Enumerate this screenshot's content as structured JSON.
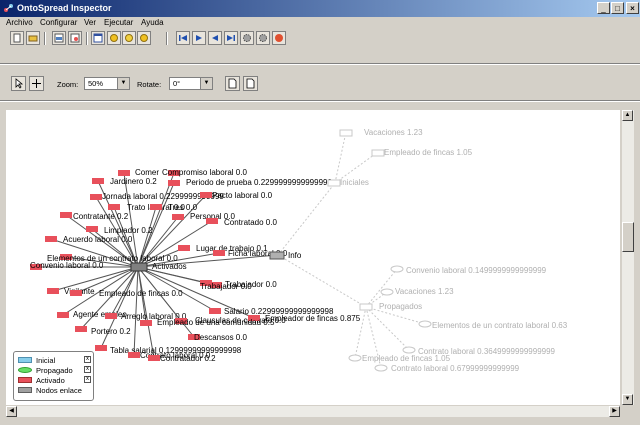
{
  "window": {
    "title": "OntoSpread Inspector"
  },
  "menu": [
    "Archivo",
    "Configurar",
    "Ver",
    "Ejecutar",
    "Ayuda"
  ],
  "options": {
    "zoom_label": "Zoom:",
    "zoom_value": "50%",
    "rotate_label": "Rotate:",
    "rotate_value": "0°"
  },
  "legend": {
    "items": [
      {
        "label": "Inicial",
        "color": "#87ceeb",
        "shape": "rect"
      },
      {
        "label": "Propagado",
        "color": "#66dd66",
        "shape": "ellipse"
      },
      {
        "label": "Activado",
        "color": "#e8505b",
        "shape": "rect"
      },
      {
        "label": "Nodos enlace",
        "color": "#a0a0a0",
        "shape": "rect"
      }
    ]
  },
  "colors": {
    "active": "#e8505b",
    "faded": "#c8c8c8",
    "hub": "#808080"
  },
  "graph": {
    "hub_label": "Activados",
    "info_label": "Info",
    "iniciales_label": "Iniciales",
    "propagados_label": "Propagados",
    "active_nodes": [
      "Comer",
      "Compromiso laboral 0.0",
      "Jardinero 0.2",
      "Periodo de prueba 0.2299999999999999",
      "Jornada laboral 0.2299999999999",
      "Pacto laboral 0.0",
      "Trato laboral 0.0",
      "Contratante 0.2",
      "Tres 0.0",
      "Personal 0.0",
      "Limpiador 0.2",
      "Contratado 0.0",
      "Acuerdo laboral 0.0",
      "Elementos de un contrato laboral 0.0",
      "Lugar de trabajo 0.1",
      "Ficha laboral 0.0",
      "Convenio laboral 0.0",
      "Trabajador 0.0",
      "Vigilante",
      "Empleado de fincas 0.0",
      "Trabajador 0.0",
      "Salario 0.22999999999999998",
      "Agente empleo",
      "Arreglo laboral 0.0",
      "Clausulas de contrato 0.0",
      "Empleador de fincas 0.875",
      "Empleado de una comunidad 0.5",
      "Portero 0.2",
      "Descansos 0.0",
      "Tabla salarial 0.12999999999999998",
      "Contrato laboral 0.0",
      "Contratador 0.2"
    ],
    "faded_nodes": [
      "Vacaciones 1.23",
      "Empleado de fincas 1.05",
      "Convenio laboral 0.1499999999999999",
      "Vacaciones 1.23",
      "Elementos de un contrato laboral 0.63",
      "Contrato laboral 0.3649999999999999",
      "Empleado de fincas 1.05",
      "Contrato laboral 0.67999999999999"
    ]
  }
}
